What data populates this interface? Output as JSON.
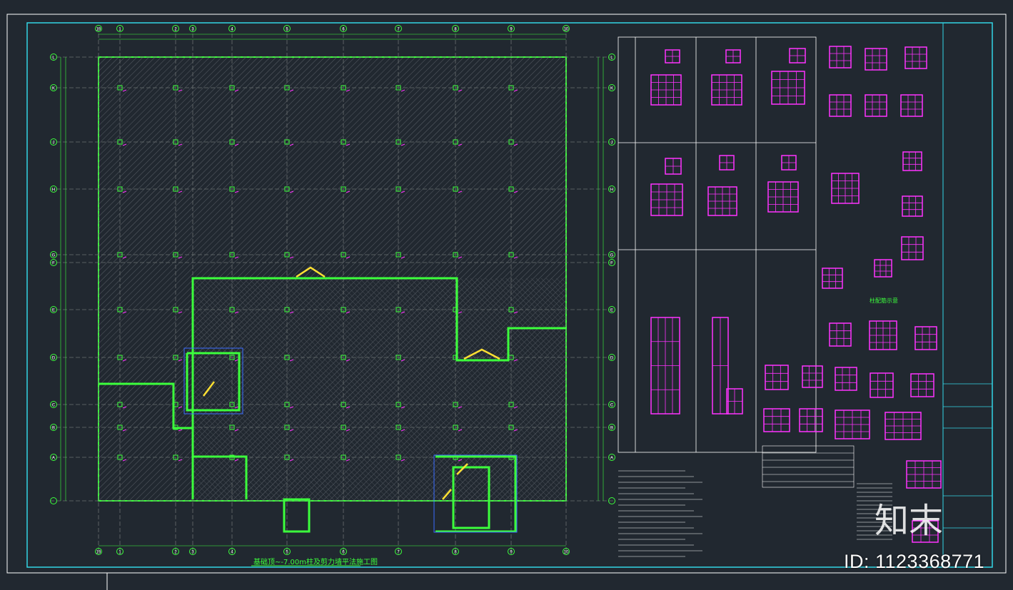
{
  "drawing": {
    "plan_title": "基础顶~-7.00m柱及剪力墙平法施工图",
    "section_title": "柱配筋示意",
    "id_label": "ID: 1123368771",
    "logo_label": "知末",
    "grid_col_labels": [
      "19",
      "1",
      "2",
      "3",
      "4",
      "5",
      "6",
      "7",
      "8",
      "9",
      "10"
    ],
    "grid_row_labels": [
      "L",
      "K",
      "J",
      "H",
      "G",
      "F",
      "E",
      "D",
      "C",
      "B",
      "A"
    ]
  },
  "colors": {
    "background": "#212830",
    "frame": "#33d6e6",
    "grid": "#3cff3c",
    "column": "#ff33ff",
    "wall": "#3cff3c",
    "annotation": "#ffe033"
  }
}
